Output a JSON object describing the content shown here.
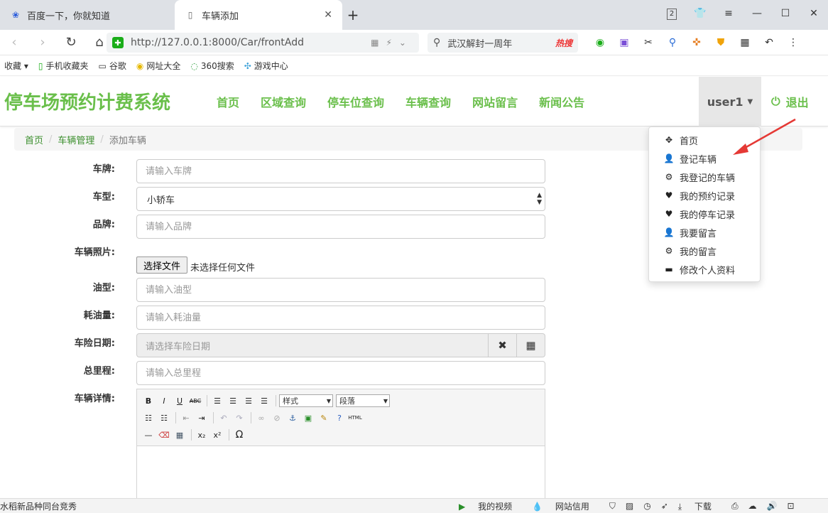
{
  "browser": {
    "tabs": [
      {
        "title": "百度一下，你就知道",
        "icon": "baidu-paw-icon"
      },
      {
        "title": "车辆添加",
        "icon": "page-icon"
      }
    ],
    "tab_count_badge": "2",
    "url": "http://127.0.0.1:8000/Car/frontAdd",
    "search_query": "武汉解封一周年",
    "search_hot_label": "热搜",
    "bookmarks": [
      "收藏",
      "手机收藏夹",
      "谷歌",
      "网址大全",
      "360搜索",
      "游戏中心"
    ]
  },
  "site": {
    "brand": "停车场预约计费系统",
    "nav": [
      "首页",
      "区域查询",
      "停车位查询",
      "车辆查询",
      "网站留言",
      "新闻公告"
    ],
    "user": "user1",
    "logout": "退出"
  },
  "breadcrumb": {
    "home": "首页",
    "section": "车辆管理",
    "current": "添加车辆",
    "separator": "/"
  },
  "form": {
    "plate": {
      "label": "车牌:",
      "placeholder": "请输入车牌"
    },
    "type": {
      "label": "车型:",
      "value": "小轿车"
    },
    "brand": {
      "label": "品牌:",
      "placeholder": "请输入品牌"
    },
    "photo": {
      "label": "车辆照片:",
      "button": "选择文件",
      "status": "未选择任何文件"
    },
    "fuel": {
      "label": "油型:",
      "placeholder": "请输入油型"
    },
    "consumption": {
      "label": "耗油量:",
      "placeholder": "请输入耗油量"
    },
    "insurance_date": {
      "label": "车险日期:",
      "placeholder": "请选择车险日期"
    },
    "mileage": {
      "label": "总里程:",
      "placeholder": "请输入总里程"
    },
    "details": {
      "label": "车辆详情:",
      "style_select": "样式",
      "para_select": "段落"
    }
  },
  "dropdown": {
    "items": [
      {
        "label": "首页",
        "icon": "move-arrows-icon"
      },
      {
        "label": "登记车辆",
        "icon": "user-icon"
      },
      {
        "label": "我登记的车辆",
        "icon": "gear-icon"
      },
      {
        "label": "我的预约记录",
        "icon": "heart-icon"
      },
      {
        "label": "我的停车记录",
        "icon": "heart-icon"
      },
      {
        "label": "我要留言",
        "icon": "user-icon"
      },
      {
        "label": "我的留言",
        "icon": "gear-icon"
      },
      {
        "label": "修改个人资料",
        "icon": "credit-card-icon"
      }
    ]
  },
  "statusbar": {
    "left": "水稻新品种同台竞秀",
    "video": "我的视频",
    "credit": "网站信用",
    "download": "下载"
  },
  "colors": {
    "brand_green": "#6abf4b",
    "link_green": "#3c8f2e",
    "annotation_red": "#e53935"
  }
}
